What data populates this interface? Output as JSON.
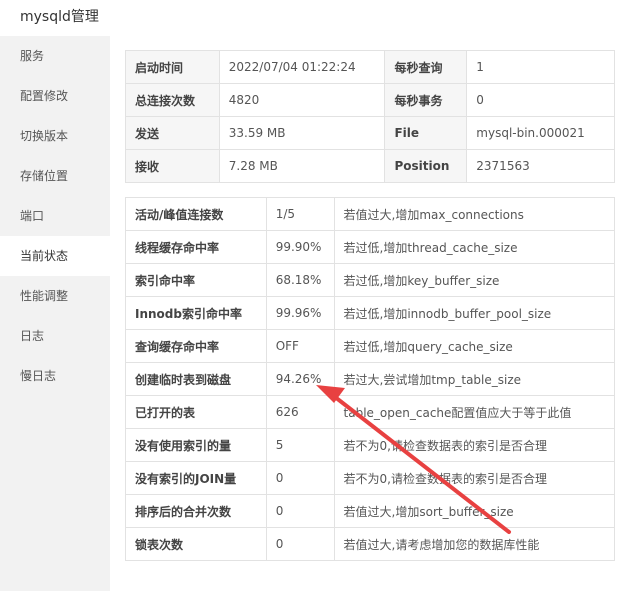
{
  "window": {
    "title": "mysqld管理"
  },
  "sidebar": {
    "items": [
      {
        "label": "服务",
        "active": false
      },
      {
        "label": "配置修改",
        "active": false
      },
      {
        "label": "切换版本",
        "active": false
      },
      {
        "label": "存储位置",
        "active": false
      },
      {
        "label": "端口",
        "active": false
      },
      {
        "label": "当前状态",
        "active": true
      },
      {
        "label": "性能调整",
        "active": false
      },
      {
        "label": "日志",
        "active": false
      },
      {
        "label": "慢日志",
        "active": false
      }
    ]
  },
  "summary": {
    "rows": [
      {
        "k1": "启动时间",
        "v1": "2022/07/04 01:22:24",
        "k2": "每秒查询",
        "v2": "1"
      },
      {
        "k1": "总连接次数",
        "v1": "4820",
        "k2": "每秒事务",
        "v2": "0"
      },
      {
        "k1": "发送",
        "v1": "33.59 MB",
        "k2": "File",
        "v2": "mysql-bin.000021"
      },
      {
        "k1": "接收",
        "v1": "7.28 MB",
        "k2": "Position",
        "v2": "2371563"
      }
    ]
  },
  "status": {
    "rows": [
      {
        "name": "活动/峰值连接数",
        "value": "1/5",
        "tip": "若值过大,增加max_connections"
      },
      {
        "name": "线程缓存命中率",
        "value": "99.90%",
        "tip": "若过低,增加thread_cache_size"
      },
      {
        "name": "索引命中率",
        "value": "68.18%",
        "tip": "若过低,增加key_buffer_size"
      },
      {
        "name": "Innodb索引命中率",
        "value": "99.96%",
        "tip": "若过低,增加innodb_buffer_pool_size"
      },
      {
        "name": "查询缓存命中率",
        "value": "OFF",
        "tip": "若过低,增加query_cache_size"
      },
      {
        "name": "创建临时表到磁盘",
        "value": "94.26%",
        "tip": "若过大,尝试增加tmp_table_size"
      },
      {
        "name": "已打开的表",
        "value": "626",
        "tip": "table_open_cache配置值应大于等于此值"
      },
      {
        "name": "没有使用索引的量",
        "value": "5",
        "tip": "若不为0,请检查数据表的索引是否合理"
      },
      {
        "name": "没有索引的JOIN量",
        "value": "0",
        "tip": "若不为0,请检查数据表的索引是否合理"
      },
      {
        "name": "排序后的合并次数",
        "value": "0",
        "tip": "若值过大,增加sort_buffer_size"
      },
      {
        "name": "锁表次数",
        "value": "0",
        "tip": "若值过大,请考虑增加您的数据库性能"
      }
    ]
  },
  "annotation": {
    "color": "#e84141"
  }
}
